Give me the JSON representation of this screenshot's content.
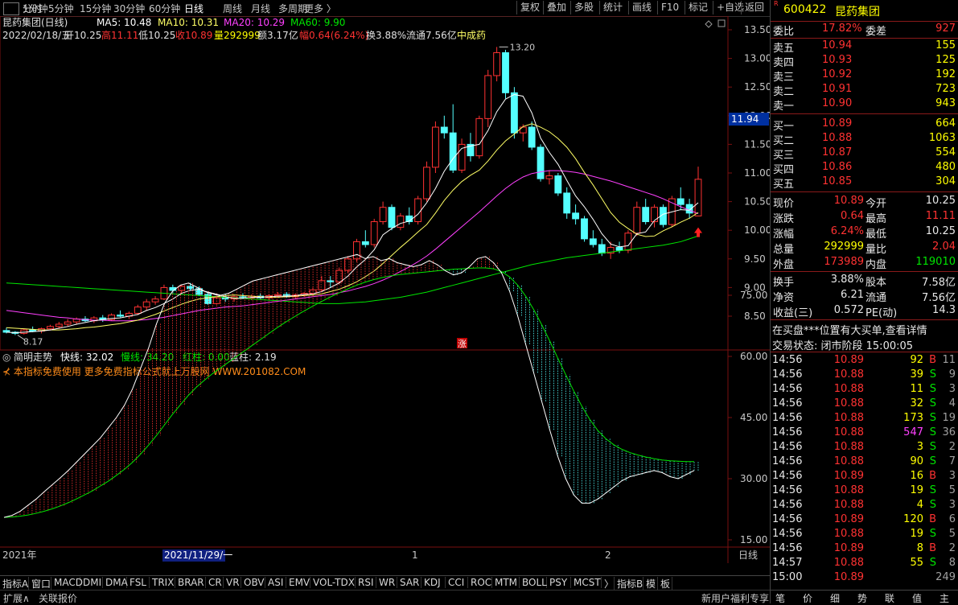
{
  "top_tabs": [
    "分时",
    "1分钟",
    "5分钟",
    "15分钟",
    "30分钟",
    "60分钟",
    "日线",
    "周线",
    "月线",
    "多周期",
    "更多 〉"
  ],
  "top_buttons": [
    "复权",
    "叠加",
    "多股",
    "统计",
    "画线",
    "F10",
    "标记",
    "+自选",
    "返回"
  ],
  "chart_header": {
    "name": "昆药集团(日线)",
    "ma5": "MA5: 10.48",
    "ma10": "MA10: 10.31",
    "ma20": "MA20: 10.29",
    "ma60": "MA60: 9.90",
    "date": "2022/02/18/五",
    "open": "开10.25",
    "high": "高11.11",
    "low": "低10.25",
    "close": "收10.89",
    "vol": "量292999",
    "amount": "额3.17亿",
    "range": "幅0.64(6.24%)",
    "turnover": "换3.88%",
    "float": "流通7.56亿",
    "sector": "中成药"
  },
  "price_axis": [
    "13.50",
    "13.00",
    "12.50",
    "12.00",
    "11.50",
    "11.00",
    "10.50",
    "10.00",
    "9.50",
    "9.00",
    "8.50"
  ],
  "current_price_tag": "11.94",
  "high_marker": "13.20",
  "low_marker": "8.17",
  "limit_marker": "涨",
  "indicator_header": {
    "name": "简明走势",
    "fast": "快线: 32.02",
    "slow": "慢线: 34.20",
    "red": "红柱: 0.00",
    "blue": "蓝柱: 2.19",
    "promo": "本指标免费使用 更多免费指标公式就上万股网 WWW.201082.COM"
  },
  "indicator_axis": [
    "75.00",
    "60.00",
    "45.00",
    "30.00",
    "15.00"
  ],
  "date_axis": {
    "year": "2021年",
    "cursor": "2021/11/29/一",
    "m1": "1",
    "m2": "2",
    "period": "日线"
  },
  "bottom_tabs": [
    "指标A",
    "窗口",
    "MACD",
    "DMI",
    "DMA",
    "FSL",
    "TRIX",
    "BRAR",
    "CR",
    "VR",
    "OBV",
    "ASI",
    "EMV",
    "VOL-TDX",
    "RSI",
    "WR",
    "SAR",
    "KDJ",
    "CCI",
    "ROC",
    "MTM",
    "BOLL",
    "PSY",
    "MCST",
    "〉",
    "指标B",
    "模",
    "板"
  ],
  "status_bar": {
    "expand": "扩展∧",
    "linked": "关联报价",
    "promo": "新用户福利专享",
    "icons": [
      "笔",
      "价",
      "细",
      "势",
      "联",
      "值",
      "主"
    ]
  },
  "quote": {
    "code": "600422",
    "name": "昆药集团",
    "weibi_label": "委比",
    "weibi": "17.82%",
    "weicha_label": "委差",
    "weicha": "927",
    "asks": [
      {
        "label": "卖五",
        "price": "10.94",
        "vol": "155"
      },
      {
        "label": "卖四",
        "price": "10.93",
        "vol": "125"
      },
      {
        "label": "卖三",
        "price": "10.92",
        "vol": "192"
      },
      {
        "label": "卖二",
        "price": "10.91",
        "vol": "723"
      },
      {
        "label": "卖一",
        "price": "10.90",
        "vol": "943"
      }
    ],
    "bids": [
      {
        "label": "买一",
        "price": "10.89",
        "vol": "664"
      },
      {
        "label": "买二",
        "price": "10.88",
        "vol": "1063"
      },
      {
        "label": "买三",
        "price": "10.87",
        "vol": "554"
      },
      {
        "label": "买四",
        "price": "10.86",
        "vol": "480"
      },
      {
        "label": "买五",
        "price": "10.85",
        "vol": "304"
      }
    ],
    "stats": [
      {
        "l1": "现价",
        "v1": "10.89",
        "l2": "今开",
        "v2": "10.25",
        "c1": "red",
        "c2": "white"
      },
      {
        "l1": "涨跌",
        "v1": "0.64",
        "l2": "最高",
        "v2": "11.11",
        "c1": "red",
        "c2": "red"
      },
      {
        "l1": "涨幅",
        "v1": "6.24%",
        "l2": "最低",
        "v2": "10.25",
        "c1": "red",
        "c2": "white"
      },
      {
        "l1": "总量",
        "v1": "292999",
        "l2": "量比",
        "v2": "2.04",
        "c1": "yellow",
        "c2": "red"
      },
      {
        "l1": "外盘",
        "v1": "173989",
        "l2": "内盘",
        "v2": "119010",
        "c1": "red",
        "c2": "green"
      }
    ],
    "stats2": [
      {
        "l1": "换手",
        "v1": "3.88%",
        "l2": "股本",
        "v2": "7.58亿"
      },
      {
        "l1": "净资",
        "v1": "6.21",
        "l2": "流通",
        "v2": "7.56亿"
      },
      {
        "l1": "收益(三)",
        "v1": "0.572",
        "l2": "PE(动)",
        "v2": "14.3"
      }
    ],
    "notice": "在买盘***位置有大买单,查看详情",
    "trade_state": "交易状态: 闭市阶段 15:00:05",
    "ticks": [
      {
        "t": "14:56",
        "p": "10.89",
        "v": "92",
        "s": "B",
        "n": "11"
      },
      {
        "t": "14:56",
        "p": "10.88",
        "v": "39",
        "s": "S",
        "n": "9"
      },
      {
        "t": "14:56",
        "p": "10.88",
        "v": "11",
        "s": "S",
        "n": "3"
      },
      {
        "t": "14:56",
        "p": "10.88",
        "v": "32",
        "s": "S",
        "n": "4"
      },
      {
        "t": "14:56",
        "p": "10.88",
        "v": "173",
        "s": "S",
        "n": "19"
      },
      {
        "t": "14:56",
        "p": "10.88",
        "v": "547",
        "s": "S",
        "n": "36"
      },
      {
        "t": "14:56",
        "p": "10.88",
        "v": "3",
        "s": "S",
        "n": "2"
      },
      {
        "t": "14:56",
        "p": "10.88",
        "v": "90",
        "s": "S",
        "n": "7"
      },
      {
        "t": "14:56",
        "p": "10.89",
        "v": "16",
        "s": "B",
        "n": "3"
      },
      {
        "t": "14:56",
        "p": "10.88",
        "v": "19",
        "s": "S",
        "n": "5"
      },
      {
        "t": "14:56",
        "p": "10.88",
        "v": "4",
        "s": "S",
        "n": "3"
      },
      {
        "t": "14:56",
        "p": "10.89",
        "v": "120",
        "s": "B",
        "n": "6"
      },
      {
        "t": "14:56",
        "p": "10.88",
        "v": "19",
        "s": "S",
        "n": "5"
      },
      {
        "t": "14:56",
        "p": "10.89",
        "v": "8",
        "s": "B",
        "n": "2"
      },
      {
        "t": "14:57",
        "p": "10.88",
        "v": "55",
        "s": "S",
        "n": "8"
      },
      {
        "t": "15:00",
        "p": "10.89",
        "v": "",
        "s": "",
        "n": "249"
      }
    ]
  },
  "colors": {
    "up": "#ff3232",
    "down": "#54ffff",
    "ma5": "#ffffff",
    "ma10": "#ffff66",
    "ma20": "#ff40ff",
    "ma60": "#00e600"
  },
  "chart_data": {
    "type": "candlestick",
    "candles": [
      [
        8.25,
        8.3,
        8.2,
        8.22
      ],
      [
        8.22,
        8.24,
        8.17,
        8.2
      ],
      [
        8.2,
        8.28,
        8.18,
        8.26
      ],
      [
        8.26,
        8.32,
        8.22,
        8.24
      ],
      [
        8.24,
        8.3,
        8.2,
        8.28
      ],
      [
        8.28,
        8.35,
        8.25,
        8.32
      ],
      [
        8.32,
        8.4,
        8.28,
        8.36
      ],
      [
        8.36,
        8.45,
        8.32,
        8.4
      ],
      [
        8.4,
        8.48,
        8.35,
        8.45
      ],
      [
        8.45,
        8.5,
        8.4,
        8.42
      ],
      [
        8.42,
        8.5,
        8.38,
        8.47
      ],
      [
        8.47,
        8.52,
        8.4,
        8.44
      ],
      [
        8.44,
        8.55,
        8.42,
        8.52
      ],
      [
        8.52,
        8.6,
        8.48,
        8.5
      ],
      [
        8.5,
        8.58,
        8.45,
        8.55
      ],
      [
        8.55,
        8.7,
        8.52,
        8.66
      ],
      [
        8.66,
        8.8,
        8.6,
        8.75
      ],
      [
        8.75,
        8.85,
        8.7,
        8.8
      ],
      [
        8.8,
        9.05,
        8.78,
        9.0
      ],
      [
        9.0,
        9.05,
        8.9,
        8.95
      ],
      [
        8.95,
        9.05,
        8.9,
        9.02
      ],
      [
        9.02,
        9.08,
        8.95,
        8.98
      ],
      [
        8.98,
        9.02,
        8.85,
        8.88
      ],
      [
        8.88,
        8.92,
        8.7,
        8.72
      ],
      [
        8.72,
        8.85,
        8.7,
        8.82
      ],
      [
        8.82,
        8.88,
        8.75,
        8.8
      ],
      [
        8.8,
        8.86,
        8.75,
        8.84
      ],
      [
        8.84,
        8.9,
        8.8,
        8.82
      ],
      [
        8.82,
        8.88,
        8.78,
        8.85
      ],
      [
        8.85,
        8.9,
        8.8,
        8.82
      ],
      [
        8.82,
        8.88,
        8.78,
        8.86
      ],
      [
        8.86,
        8.92,
        8.82,
        8.88
      ],
      [
        8.88,
        8.92,
        8.82,
        8.84
      ],
      [
        8.84,
        8.9,
        8.8,
        8.87
      ],
      [
        8.87,
        8.92,
        8.84,
        8.9
      ],
      [
        8.9,
        9.0,
        8.86,
        8.96
      ],
      [
        8.96,
        9.2,
        8.92,
        9.12
      ],
      [
        9.12,
        9.2,
        9.0,
        9.1
      ],
      [
        9.1,
        9.35,
        9.05,
        9.3
      ],
      [
        9.3,
        9.55,
        9.25,
        9.5
      ],
      [
        9.5,
        9.85,
        9.45,
        9.8
      ],
      [
        9.8,
        10.0,
        9.7,
        9.75
      ],
      [
        9.75,
        10.2,
        9.7,
        10.15
      ],
      [
        10.15,
        10.5,
        10.1,
        10.4
      ],
      [
        10.4,
        10.45,
        10.0,
        10.05
      ],
      [
        10.05,
        10.3,
        10.0,
        10.25
      ],
      [
        10.25,
        10.4,
        10.1,
        10.15
      ],
      [
        10.15,
        10.6,
        10.1,
        10.55
      ],
      [
        10.55,
        11.2,
        10.5,
        11.1
      ],
      [
        11.1,
        11.9,
        11.0,
        11.8
      ],
      [
        11.8,
        12.0,
        11.6,
        11.7
      ],
      [
        11.7,
        12.2,
        11.0,
        11.05
      ],
      [
        11.05,
        11.6,
        11.0,
        11.5
      ],
      [
        11.5,
        11.7,
        11.2,
        11.3
      ],
      [
        11.3,
        12.0,
        11.25,
        11.95
      ],
      [
        11.95,
        12.8,
        11.8,
        12.7
      ],
      [
        12.7,
        13.2,
        12.6,
        13.1
      ],
      [
        13.1,
        13.15,
        12.3,
        12.4
      ],
      [
        12.4,
        12.5,
        11.6,
        11.7
      ],
      [
        11.7,
        11.85,
        11.55,
        11.8
      ],
      [
        11.8,
        11.9,
        11.4,
        11.45
      ],
      [
        11.45,
        11.5,
        10.85,
        10.9
      ],
      [
        10.9,
        11.05,
        10.8,
        10.95
      ],
      [
        10.95,
        11.0,
        10.6,
        10.65
      ],
      [
        10.65,
        10.75,
        10.2,
        10.3
      ],
      [
        10.3,
        10.45,
        10.1,
        10.2
      ],
      [
        10.2,
        10.25,
        9.8,
        9.85
      ],
      [
        9.85,
        10.0,
        9.7,
        9.75
      ],
      [
        9.75,
        9.85,
        9.55,
        9.6
      ],
      [
        9.6,
        9.8,
        9.5,
        9.7
      ],
      [
        9.7,
        9.8,
        9.6,
        9.65
      ],
      [
        9.65,
        10.0,
        9.6,
        9.95
      ],
      [
        9.95,
        10.5,
        9.9,
        10.4
      ],
      [
        10.4,
        10.55,
        10.1,
        10.15
      ],
      [
        10.15,
        10.45,
        10.05,
        10.4
      ],
      [
        10.4,
        10.45,
        10.05,
        10.1
      ],
      [
        10.1,
        10.6,
        10.05,
        10.55
      ],
      [
        10.55,
        10.75,
        10.35,
        10.45
      ],
      [
        10.45,
        10.55,
        10.2,
        10.3
      ],
      [
        10.25,
        11.11,
        10.25,
        10.89
      ]
    ],
    "ma5": [
      8.22,
      8.21,
      8.22,
      8.23,
      8.24,
      8.26,
      8.29,
      8.32,
      8.36,
      8.39,
      8.42,
      8.44,
      8.46,
      8.47,
      8.5,
      8.53,
      8.6,
      8.65,
      8.72,
      8.8,
      8.9,
      8.95,
      8.97,
      8.91,
      8.87,
      8.84,
      8.81,
      8.81,
      8.83,
      8.83,
      8.84,
      8.85,
      8.85,
      8.86,
      8.88,
      8.89,
      8.93,
      9.0,
      9.08,
      9.2,
      9.36,
      9.49,
      9.66,
      9.92,
      10.03,
      10.12,
      10.16,
      10.28,
      10.48,
      10.73,
      11.03,
      11.25,
      11.43,
      11.47,
      11.5,
      11.74,
      12.07,
      12.29,
      12.37,
      12.34,
      12.05,
      11.61,
      11.36,
      11.15,
      10.87,
      10.6,
      10.41,
      10.19,
      9.94,
      9.76,
      9.71,
      9.73,
      9.94,
      9.97,
      10.17,
      10.28,
      10.32,
      10.36,
      10.35,
      10.48
    ],
    "ma10": [
      8.3,
      8.29,
      8.28,
      8.27,
      8.26,
      8.26,
      8.26,
      8.27,
      8.28,
      8.3,
      8.31,
      8.33,
      8.35,
      8.37,
      8.4,
      8.43,
      8.48,
      8.53,
      8.59,
      8.65,
      8.71,
      8.76,
      8.8,
      8.82,
      8.84,
      8.86,
      8.87,
      8.86,
      8.85,
      8.84,
      8.83,
      8.83,
      8.84,
      8.85,
      8.86,
      8.87,
      8.89,
      8.93,
      8.97,
      9.03,
      9.1,
      9.19,
      9.29,
      9.42,
      9.56,
      9.7,
      9.83,
      9.97,
      10.1,
      10.3,
      10.52,
      10.7,
      10.85,
      10.96,
      11.05,
      11.21,
      11.4,
      11.56,
      11.68,
      11.81,
      11.86,
      11.8,
      11.72,
      11.6,
      11.45,
      11.25,
      11.01,
      10.79,
      10.55,
      10.31,
      10.14,
      10.03,
      9.93,
      9.89,
      9.9,
      9.99,
      10.06,
      10.14,
      10.21,
      10.31
    ],
    "ma20": [
      8.6,
      8.58,
      8.56,
      8.54,
      8.52,
      8.5,
      8.48,
      8.47,
      8.45,
      8.44,
      8.43,
      8.43,
      8.42,
      8.42,
      8.42,
      8.43,
      8.44,
      8.46,
      8.48,
      8.51,
      8.54,
      8.57,
      8.6,
      8.62,
      8.64,
      8.66,
      8.67,
      8.68,
      8.7,
      8.72,
      8.74,
      8.76,
      8.78,
      8.8,
      8.82,
      8.84,
      8.86,
      8.88,
      8.91,
      8.94,
      8.98,
      9.02,
      9.07,
      9.13,
      9.2,
      9.28,
      9.36,
      9.45,
      9.55,
      9.67,
      9.8,
      9.93,
      10.06,
      10.19,
      10.32,
      10.46,
      10.6,
      10.73,
      10.84,
      10.93,
      10.99,
      11.02,
      11.04,
      11.04,
      11.03,
      11.01,
      10.98,
      10.94,
      10.9,
      10.86,
      10.81,
      10.76,
      10.71,
      10.66,
      10.61,
      10.55,
      10.48,
      10.41,
      10.35,
      10.29
    ],
    "ma60": [
      9.08,
      9.07,
      9.06,
      9.05,
      9.04,
      9.03,
      9.02,
      9.01,
      9.0,
      8.99,
      8.98,
      8.97,
      8.96,
      8.95,
      8.94,
      8.93,
      8.92,
      8.91,
      8.9,
      8.89,
      8.88,
      8.87,
      8.86,
      8.85,
      8.84,
      8.83,
      8.82,
      8.81,
      8.8,
      8.79,
      8.78,
      8.77,
      8.76,
      8.75,
      8.74,
      8.73,
      8.72,
      8.72,
      8.72,
      8.73,
      8.74,
      8.75,
      8.77,
      8.79,
      8.81,
      8.83,
      8.86,
      8.89,
      8.92,
      8.96,
      9.0,
      9.04,
      9.08,
      9.12,
      9.16,
      9.2,
      9.24,
      9.28,
      9.32,
      9.36,
      9.4,
      9.43,
      9.46,
      9.49,
      9.52,
      9.54,
      9.56,
      9.58,
      9.6,
      9.62,
      9.64,
      9.66,
      9.68,
      9.7,
      9.72,
      9.74,
      9.77,
      9.8,
      9.85,
      9.9
    ],
    "ind_fast": [
      20.5,
      21.0,
      22.0,
      23.5,
      25.0,
      26.8,
      28.5,
      30.2,
      32.0,
      34.0,
      36.0,
      38.0,
      40.0,
      42.5,
      45.0,
      48.0,
      52.0,
      57.0,
      62.0,
      68.0,
      73.0,
      76.0,
      77.5,
      78.0,
      77.0,
      76.0,
      75.5,
      75.0,
      75.5,
      76.5,
      77.5,
      78.5,
      79.0,
      79.5,
      80.0,
      80.5,
      81.0,
      81.5,
      82.0,
      82.5,
      83.0,
      83.5,
      84.0,
      84.5,
      85.0,
      84.0,
      84.5,
      83.5,
      84.0,
      83.0,
      82.5,
      82.0,
      82.5,
      83.5,
      82.5,
      81.0,
      80.0,
      80.5,
      82.0,
      84.0,
      84.5,
      83.0,
      80.5,
      76.0,
      70.0,
      63.0,
      56.0,
      49.0,
      42.0,
      35.5,
      30.0,
      26.0,
      24.0,
      24.0,
      25.0,
      26.5,
      28.0,
      29.5,
      30.5,
      31.0,
      31.5,
      32.0,
      31.5,
      30.5,
      30.0,
      31.0,
      32.0
    ],
    "ind_slow": [
      20.5,
      20.6,
      20.8,
      21.1,
      21.5,
      22.0,
      22.6,
      23.3,
      24.1,
      25.0,
      26.0,
      27.0,
      28.2,
      29.4,
      30.8,
      32.3,
      34.0,
      36.0,
      38.2,
      40.6,
      43.2,
      45.8,
      48.2,
      50.5,
      52.5,
      54.2,
      55.8,
      57.2,
      58.6,
      60.0,
      61.4,
      62.8,
      64.2,
      65.6,
      67.0,
      68.3,
      69.5,
      70.7,
      71.8,
      72.9,
      73.9,
      74.9,
      75.8,
      76.7,
      77.5,
      78.2,
      78.8,
      79.3,
      79.7,
      80.0,
      80.2,
      80.4,
      80.6,
      80.8,
      81.0,
      81.2,
      81.4,
      81.5,
      81.6,
      81.7,
      81.7,
      81.5,
      80.8,
      79.5,
      77.5,
      74.8,
      71.5,
      67.8,
      63.8,
      59.6,
      55.5,
      51.5,
      47.8,
      44.5,
      41.8,
      39.8,
      38.3,
      37.2,
      36.4,
      35.8,
      35.3,
      34.9,
      34.6,
      34.4,
      34.3,
      34.2,
      34.2
    ]
  }
}
